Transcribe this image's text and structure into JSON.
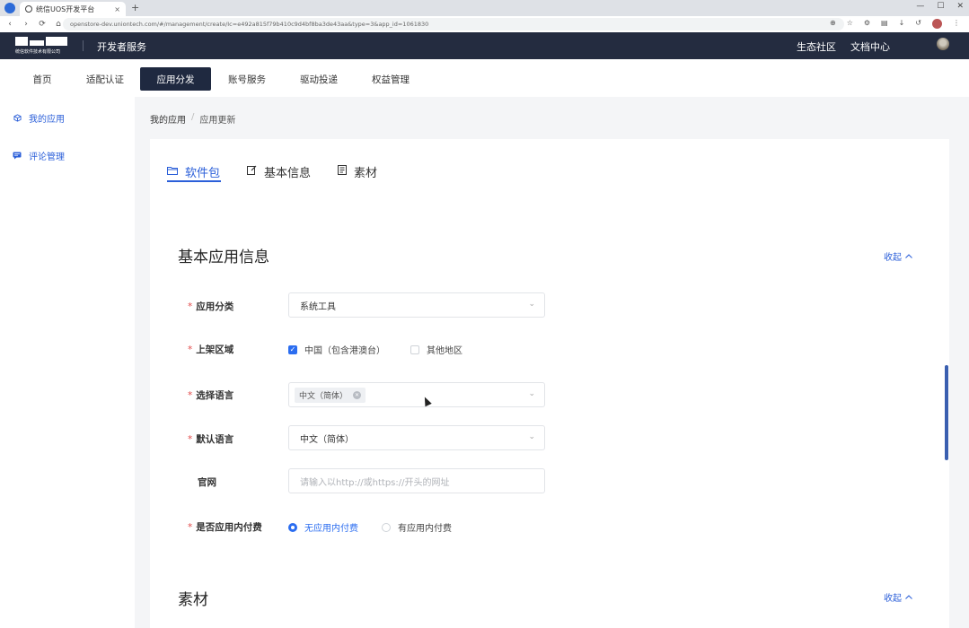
{
  "browser": {
    "tab_title": "统信UOS开发平台",
    "tab_close": "×",
    "new_tab": "+",
    "url": "openstore-dev.uniontech.com/#/management/create/Ic=e492a815f79b410c9d4bf8ba3de43aa&type=3&app_id=1061830",
    "back": "‹",
    "forward": "›",
    "reload": "⟳",
    "home": "⌂"
  },
  "header": {
    "logo_subtext": "统信软件技术有限公司",
    "title": "开发者服务",
    "links": [
      "生态社区",
      "文档中心"
    ]
  },
  "nav": {
    "items": [
      "首页",
      "适配认证",
      "应用分发",
      "账号服务",
      "驱动投递",
      "权益管理"
    ],
    "active_index": 2
  },
  "sidebar": {
    "items": [
      {
        "label": "我的应用",
        "icon": "box-icon"
      },
      {
        "label": "评论管理",
        "icon": "comment-icon"
      }
    ]
  },
  "breadcrumb": {
    "parent": "我的应用",
    "separator": "/",
    "current": "应用更新"
  },
  "tabs": [
    {
      "label": "软件包",
      "icon": "folder-icon",
      "active": true
    },
    {
      "label": "基本信息",
      "icon": "edit-icon",
      "active": false
    },
    {
      "label": "素材",
      "icon": "document-icon",
      "active": false
    }
  ],
  "section_basic": {
    "title": "基本应用信息",
    "collapse_label": "收起",
    "fields": {
      "category": {
        "label": "应用分类",
        "value": "系统工具"
      },
      "region": {
        "label": "上架区域",
        "options": [
          "中国（包含港澳台）",
          "其他地区"
        ],
        "checked": [
          true,
          false
        ]
      },
      "language": {
        "label": "选择语言",
        "chip": "中文（简体）"
      },
      "default_language": {
        "label": "默认语言",
        "value": "中文（简体）"
      },
      "website": {
        "label": "官网",
        "placeholder": "请输入以http://或https://开头的网址"
      },
      "iap": {
        "label": "是否应用内付费",
        "options": [
          "无应用内付费",
          "有应用内付费"
        ],
        "selected_index": 0
      }
    }
  },
  "section_assets": {
    "title": "素材",
    "collapse_label": "收起"
  },
  "colors": {
    "header_bg": "#242c40",
    "accent": "#2b5fd9",
    "required": "#e34d4d"
  }
}
